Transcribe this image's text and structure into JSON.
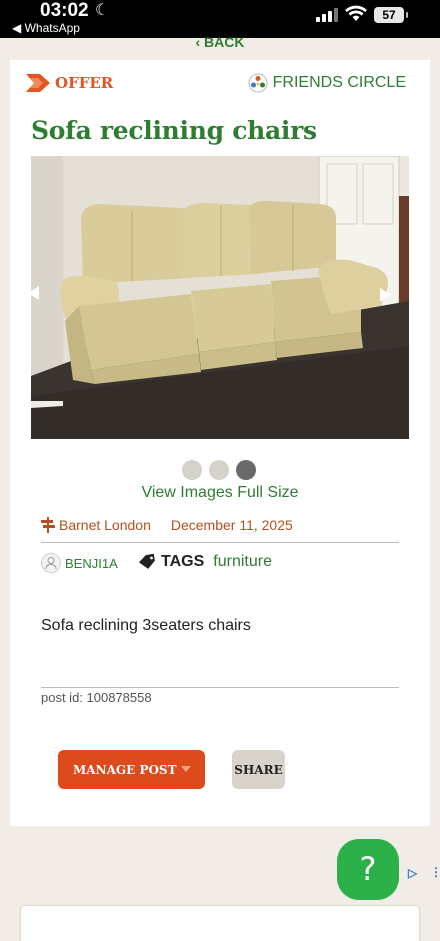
{
  "status_bar": {
    "time": "03:02",
    "back_app": "◀ WhatsApp",
    "battery": "57"
  },
  "nav": {
    "back_label": "‹ BACK"
  },
  "header": {
    "offer_label": "OFFER",
    "circle_label": "FRIENDS CIRCLE"
  },
  "post": {
    "title": "Sofa reclining chairs",
    "image_count": 3,
    "active_image": 3,
    "view_full_label": "View Images Full Size",
    "location": "Barnet London",
    "date": "December 11, 2025",
    "author": "BENJI1A",
    "tags_label": "TAGS",
    "tag": "furniture",
    "description": "Sofa reclining 3seaters chairs",
    "post_id": "post id: 100878558"
  },
  "actions": {
    "manage_label": "MANAGE POST",
    "share_label": "SHARE"
  },
  "help": {
    "label": "?"
  },
  "colors": {
    "green": "#2e7d32",
    "orange": "#e25420",
    "button_orange": "#dd4a1c",
    "help_green": "#2bb04a"
  },
  "icons": [
    "moon-icon",
    "signal-icon",
    "wifi-icon",
    "battery-icon",
    "offer-arrow-icon",
    "friends-circle-icon",
    "arrow-left-icon",
    "arrow-right-icon",
    "signpost-icon",
    "user-icon",
    "tag-icon",
    "caret-down-icon",
    "adchoices-icon"
  ]
}
